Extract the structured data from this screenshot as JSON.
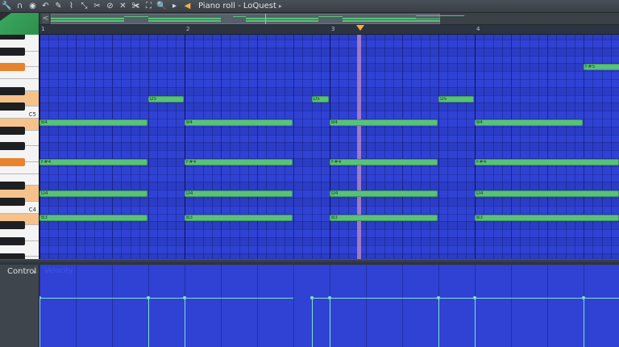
{
  "window": {
    "title": "Piano roll - LoQuest",
    "tools": [
      {
        "name": "wrench-icon",
        "glyph": "🔧"
      },
      {
        "name": "magnet-icon",
        "glyph": "∩"
      },
      {
        "name": "record-icon",
        "glyph": "◉"
      },
      {
        "name": "undo-icon",
        "glyph": "↶"
      },
      {
        "name": "pencil-icon",
        "glyph": "✎"
      },
      {
        "name": "brush-icon",
        "glyph": "⌇"
      },
      {
        "name": "select-icon",
        "glyph": "⤡"
      },
      {
        "name": "slice-icon",
        "glyph": "✂"
      },
      {
        "name": "delete-icon",
        "glyph": "⊘"
      },
      {
        "name": "mute-icon",
        "glyph": "✕"
      },
      {
        "name": "scissors-icon",
        "glyph": "✀"
      },
      {
        "name": "zoom-fit-icon",
        "glyph": "⛶"
      },
      {
        "name": "zoom-icon",
        "glyph": "🔍"
      },
      {
        "name": "play-icon",
        "glyph": "▸"
      },
      {
        "name": "speaker-icon",
        "glyph": "◀"
      }
    ],
    "menu_arrow": "▸"
  },
  "overview": {
    "left_button": "<"
  },
  "timeline": {
    "bars": [
      "1",
      "2",
      "3",
      "4"
    ]
  },
  "keyboard": {
    "labels": [
      {
        "text": "C5"
      },
      {
        "text": "C4"
      }
    ]
  },
  "notes": [
    {
      "label": "F#5",
      "row": "F#5",
      "bar": 4.75,
      "len": 0.5
    },
    {
      "label": "D5",
      "row": "D5",
      "bar": 1.75,
      "len": 0.25
    },
    {
      "label": "D5",
      "row": "D5",
      "bar": 2.875,
      "len": 0.125
    },
    {
      "label": "D5",
      "row": "D5",
      "bar": 3.75,
      "len": 0.25
    },
    {
      "label": "B4",
      "row": "B4",
      "bar": 1,
      "len": 0.75
    },
    {
      "label": "B4",
      "row": "B4",
      "bar": 2,
      "len": 0.75
    },
    {
      "label": "B4",
      "row": "B4",
      "bar": 3,
      "len": 0.75
    },
    {
      "label": "B4",
      "row": "B4",
      "bar": 4,
      "len": 0.75
    },
    {
      "label": "F#4",
      "row": "F#4",
      "bar": 1,
      "len": 0.75
    },
    {
      "label": "F#4",
      "row": "F#4",
      "bar": 2,
      "len": 0.75
    },
    {
      "label": "F#4",
      "row": "F#4",
      "bar": 3,
      "len": 0.75
    },
    {
      "label": "F#4",
      "row": "F#4",
      "bar": 4,
      "len": 1.0
    },
    {
      "label": "D4",
      "row": "D4",
      "bar": 1,
      "len": 0.75
    },
    {
      "label": "D4",
      "row": "D4",
      "bar": 2,
      "len": 0.75
    },
    {
      "label": "D4",
      "row": "D4",
      "bar": 3,
      "len": 0.75
    },
    {
      "label": "D4",
      "row": "D4",
      "bar": 4,
      "len": 1.0
    },
    {
      "label": "B3",
      "row": "B3",
      "bar": 1,
      "len": 0.75
    },
    {
      "label": "B3",
      "row": "B3",
      "bar": 2,
      "len": 0.75
    },
    {
      "label": "B3",
      "row": "B3",
      "bar": 3,
      "len": 0.75
    },
    {
      "label": "B3",
      "row": "B3",
      "bar": 4,
      "len": 1.0
    }
  ],
  "playhead_bar": 3.2,
  "control": {
    "label": "Control",
    "arrow": "▸",
    "parameter": "Velocity",
    "velocity_level": 0.78
  },
  "colors": {
    "grid": "#2f42d4",
    "note": "#59c17a",
    "velocity": "#7fe2cc",
    "playhead": "#f4b13a",
    "key_highlight": "#f6c28c"
  }
}
